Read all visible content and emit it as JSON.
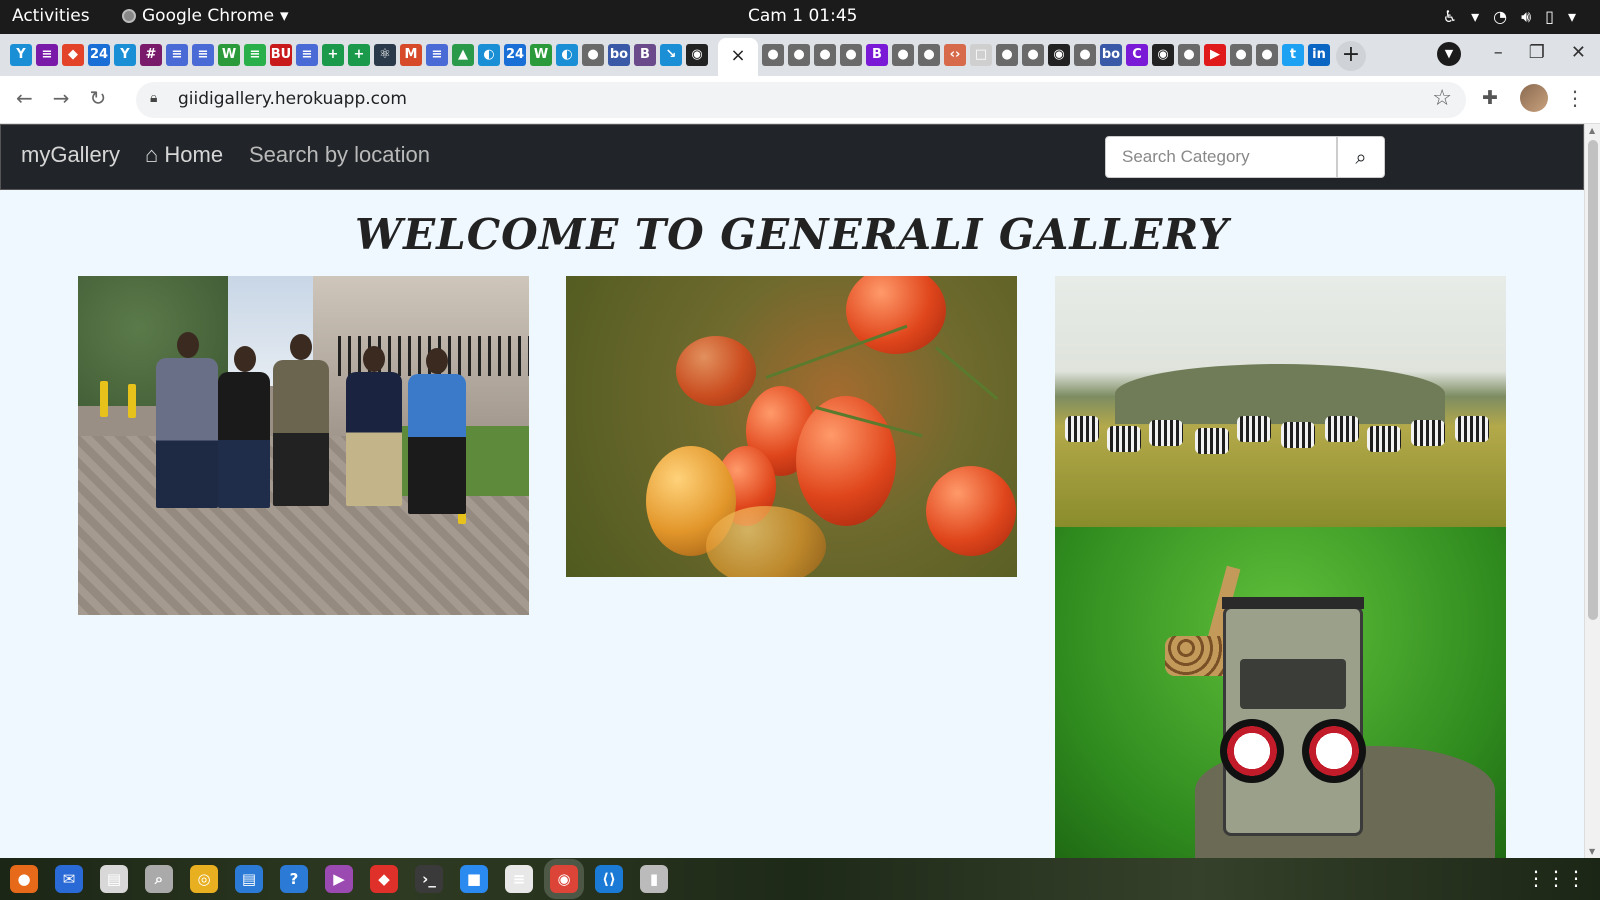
{
  "topbar": {
    "activities": "Activities",
    "app_name": "Google Chrome",
    "clock": "Cam 1  01:45",
    "tray_icons": [
      "accessibility-icon",
      "wifi-icon",
      "volume-icon",
      "battery-icon"
    ]
  },
  "browser": {
    "active_tab_close": "×",
    "new_tab": "+",
    "url": "giidigallery.herokuapp.com",
    "tab_favicons": [
      {
        "icon": "Y",
        "color": "#1a8fd6"
      },
      {
        "icon": "≡",
        "color": "#7a1aa8"
      },
      {
        "icon": "◆",
        "color": "#e24329"
      },
      {
        "icon": "24",
        "color": "#1a6fd6"
      },
      {
        "icon": "Y",
        "color": "#1a8fd6"
      },
      {
        "icon": "#",
        "color": "#7a1a6a"
      },
      {
        "icon": "≡",
        "color": "#4a6ad6"
      },
      {
        "icon": "≡",
        "color": "#4a6ad6"
      },
      {
        "icon": "W",
        "color": "#2a9a3a"
      },
      {
        "icon": "≡",
        "color": "#2ab04a"
      },
      {
        "icon": "BU",
        "color": "#c81a1a"
      },
      {
        "icon": "≡",
        "color": "#4a6ad6"
      },
      {
        "icon": "+",
        "color": "#1a9a4a"
      },
      {
        "icon": "+",
        "color": "#1a9a4a"
      },
      {
        "icon": "⚛",
        "color": "#2a3a4a"
      },
      {
        "icon": "M",
        "color": "#d64a2a"
      },
      {
        "icon": "≡",
        "color": "#4a6ad6"
      },
      {
        "icon": "▲",
        "color": "#2a9a4a"
      },
      {
        "icon": "◐",
        "color": "#1a8fd6"
      },
      {
        "icon": "24",
        "color": "#1a6fd6"
      },
      {
        "icon": "W",
        "color": "#2a9a3a"
      },
      {
        "icon": "◐",
        "color": "#1a8fd6"
      },
      {
        "icon": "●",
        "color": "#6a6a6a"
      },
      {
        "icon": "bo",
        "color": "#3a5aa8"
      },
      {
        "icon": "B",
        "color": "#6a4a8a"
      },
      {
        "icon": "↘",
        "color": "#1a8fd6"
      },
      {
        "icon": "◉",
        "color": "#222222"
      }
    ],
    "tab_favicons_right": [
      {
        "icon": "●",
        "color": "#6a6a6a"
      },
      {
        "icon": "●",
        "color": "#6a6a6a"
      },
      {
        "icon": "●",
        "color": "#6a6a6a"
      },
      {
        "icon": "●",
        "color": "#6a6a6a"
      },
      {
        "icon": "B",
        "color": "#7a1ad6"
      },
      {
        "icon": "●",
        "color": "#6a6a6a"
      },
      {
        "icon": "●",
        "color": "#6a6a6a"
      },
      {
        "icon": "‹›",
        "color": "#d66a4a"
      },
      {
        "icon": "□",
        "color": "#cfcfcf"
      },
      {
        "icon": "●",
        "color": "#6a6a6a"
      },
      {
        "icon": "●",
        "color": "#6a6a6a"
      },
      {
        "icon": "◉",
        "color": "#222222"
      },
      {
        "icon": "●",
        "color": "#6a6a6a"
      },
      {
        "icon": "bo",
        "color": "#3a5aa8"
      },
      {
        "icon": "C",
        "color": "#7a1ad6"
      },
      {
        "icon": "◉",
        "color": "#222222"
      },
      {
        "icon": "●",
        "color": "#6a6a6a"
      },
      {
        "icon": "▶",
        "color": "#e01a1a"
      },
      {
        "icon": "●",
        "color": "#6a6a6a"
      },
      {
        "icon": "●",
        "color": "#6a6a6a"
      },
      {
        "icon": "t",
        "color": "#1da1f2"
      },
      {
        "icon": "in",
        "color": "#0a66c2"
      }
    ]
  },
  "site": {
    "brand": "myGallery",
    "nav_home": "Home",
    "nav_location": "Search by location",
    "search_placeholder": "Search Category",
    "welcome": "WELCOME TO GENERALI GALLERY"
  },
  "taskbar": {
    "apps": [
      {
        "name": "firefox-icon",
        "color": "#e66a1a",
        "glyph": "●"
      },
      {
        "name": "thunderbird-icon",
        "color": "#2a6ad6",
        "glyph": "✉"
      },
      {
        "name": "files-icon",
        "color": "#d8d8d8",
        "glyph": "▤"
      },
      {
        "name": "image-viewer-icon",
        "color": "#aaaaaa",
        "glyph": "⌕"
      },
      {
        "name": "rhythmbox-icon",
        "color": "#e8b020",
        "glyph": "◎"
      },
      {
        "name": "libreoffice-writer-icon",
        "color": "#2a7ad6",
        "glyph": "▤"
      },
      {
        "name": "help-icon",
        "color": "#2a7ad6",
        "glyph": "?"
      },
      {
        "name": "video-icon",
        "color": "#9a4ab0",
        "glyph": "▶"
      },
      {
        "name": "anydesk-icon",
        "color": "#e0302a",
        "glyph": "◆"
      },
      {
        "name": "terminal-icon",
        "color": "#3a3a3a",
        "glyph": "›_"
      },
      {
        "name": "zoom-icon",
        "color": "#2a8af0",
        "glyph": "■"
      },
      {
        "name": "text-editor-icon",
        "color": "#e8e8e8",
        "glyph": "≡"
      },
      {
        "name": "chrome-icon",
        "color": "#db4437",
        "glyph": "◉"
      },
      {
        "name": "vscode-icon",
        "color": "#1a7ad6",
        "glyph": "⟨⟩"
      },
      {
        "name": "usb-creator-icon",
        "color": "#bbbbbb",
        "glyph": "▮"
      }
    ],
    "active_app": "chrome-icon"
  }
}
